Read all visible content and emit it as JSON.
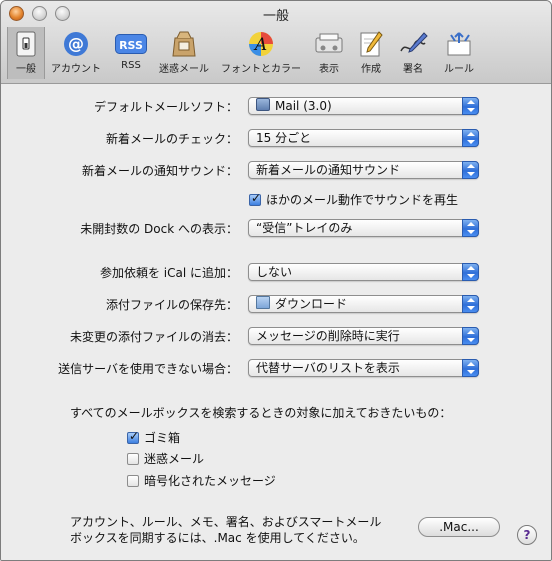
{
  "window": {
    "title": "一般"
  },
  "toolbar": {
    "items": [
      {
        "label": "一般",
        "icon": "general-switch-icon",
        "active": true
      },
      {
        "label": "アカウント",
        "icon": "at-sign-icon"
      },
      {
        "label": "RSS",
        "icon": "rss-icon"
      },
      {
        "label": "迷惑メール",
        "icon": "junk-mail-bag-icon"
      },
      {
        "label": "フォントとカラー",
        "icon": "font-color-icon"
      },
      {
        "label": "表示",
        "icon": "viewing-icon"
      },
      {
        "label": "作成",
        "icon": "compose-pencil-icon"
      },
      {
        "label": "署名",
        "icon": "signature-pen-icon"
      },
      {
        "label": "ルール",
        "icon": "rules-arrows-icon"
      }
    ]
  },
  "settings": {
    "default_mail": {
      "label": "デフォルトメールソフト：",
      "value": "Mail (3.0)",
      "icon": "mail-app-icon"
    },
    "check_mail": {
      "label": "新着メールのチェック：",
      "value": "15 分ごと"
    },
    "new_mail_sound": {
      "label": "新着メールの通知サウンド：",
      "value": "新着メールの通知サウンド"
    },
    "play_sounds": {
      "label": "ほかのメール動作でサウンドを再生",
      "checked": true
    },
    "dock_unread": {
      "label": "未開封数の Dock への表示：",
      "value": "“受信”トレイのみ"
    },
    "ical_invites": {
      "label": "参加依頼を iCal に追加：",
      "value": "しない"
    },
    "downloads_folder": {
      "label": "添付ファイルの保存先：",
      "value": "ダウンロード",
      "icon": "folder-icon"
    },
    "remove_downloads": {
      "label": "未変更の添付ファイルの消去：",
      "value": "メッセージの削除時に実行"
    },
    "outgoing_server": {
      "label": "送信サーバを使用できない場合：",
      "value": "代替サーバのリストを表示"
    }
  },
  "search": {
    "heading": "すべてのメールボックスを検索するときの対象に加えておきたいもの：",
    "options": [
      {
        "label": "ゴミ箱",
        "checked": true
      },
      {
        "label": "迷惑メール",
        "checked": false
      },
      {
        "label": "暗号化されたメッセージ",
        "checked": false
      }
    ]
  },
  "sync": {
    "line1": "アカウント、ルール、メモ、署名、およびスマートメール",
    "line2": "ボックスを同期するには、.Mac を使用してください。",
    "button": ".Mac...",
    "help": "?"
  },
  "colors": {
    "accent": "#2f6fd8",
    "window_bg": "#ececec"
  }
}
